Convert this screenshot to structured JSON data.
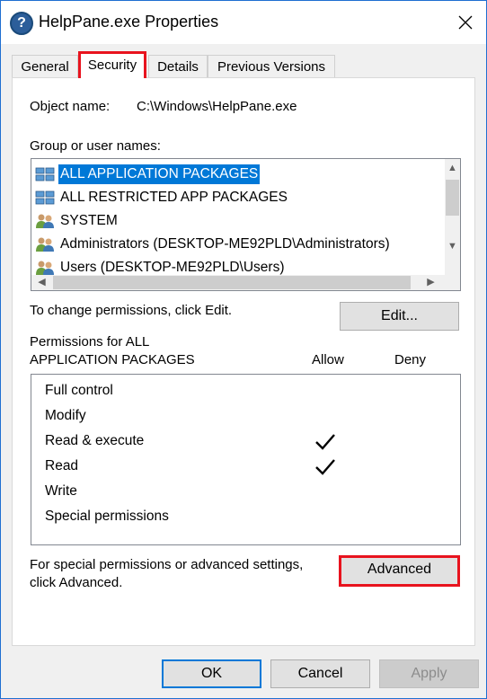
{
  "window": {
    "title": "HelpPane.exe Properties"
  },
  "tabs": [
    {
      "label": "General",
      "active": false
    },
    {
      "label": "Security",
      "active": true
    },
    {
      "label": "Details",
      "active": false
    },
    {
      "label": "Previous Versions",
      "active": false
    }
  ],
  "security": {
    "object_name_label": "Object name:",
    "object_name_value": "C:\\Windows\\HelpPane.exe",
    "group_label": "Group or user names:",
    "groups": [
      {
        "name": "ALL APPLICATION PACKAGES",
        "icon": "app-packages-icon",
        "selected": true
      },
      {
        "name": "ALL RESTRICTED APP PACKAGES",
        "icon": "app-packages-icon",
        "selected": false
      },
      {
        "name": "SYSTEM",
        "icon": "users-group-icon",
        "selected": false
      },
      {
        "name": "Administrators (DESKTOP-ME92PLD\\Administrators)",
        "icon": "users-group-icon",
        "selected": false
      },
      {
        "name": "Users (DESKTOP-ME92PLD\\Users)",
        "icon": "users-group-icon",
        "selected": false
      }
    ],
    "change_hint": "To change permissions, click Edit.",
    "edit_label": "Edit...",
    "permissions_for_line1": "Permissions for ALL",
    "permissions_for_line2": "APPLICATION PACKAGES",
    "allow_header": "Allow",
    "deny_header": "Deny",
    "permissions": [
      {
        "name": "Full control",
        "allow": false,
        "deny": false
      },
      {
        "name": "Modify",
        "allow": false,
        "deny": false
      },
      {
        "name": "Read & execute",
        "allow": true,
        "deny": false
      },
      {
        "name": "Read",
        "allow": true,
        "deny": false
      },
      {
        "name": "Write",
        "allow": false,
        "deny": false
      },
      {
        "name": "Special permissions",
        "allow": false,
        "deny": false
      }
    ],
    "advanced_hint_line1": "For special permissions or advanced settings,",
    "advanced_hint_line2": "click Advanced.",
    "advanced_label": "Advanced"
  },
  "footer": {
    "ok_label": "OK",
    "cancel_label": "Cancel",
    "apply_label": "Apply"
  },
  "colors": {
    "selection": "#0078d7",
    "highlight_box": "#e8131e",
    "window_border": "#1f6fd1"
  }
}
